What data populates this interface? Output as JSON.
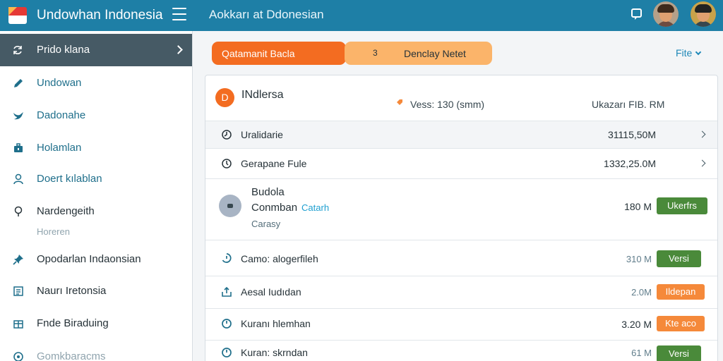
{
  "topbar": {
    "app_title": "Undowhan Indonesia",
    "page_heading": "Aokkarı at Ddonesian"
  },
  "sidebar": {
    "header_label": "Prido klana",
    "items": [
      {
        "label": "Undowan",
        "icon": "pencil-icon",
        "color": "#1f6f8b"
      },
      {
        "label": "Dadonahe",
        "icon": "bird-icon",
        "color": "#1f6f8b"
      },
      {
        "label": "Holamlan",
        "icon": "briefcase-icon",
        "color": "#1f6f8b"
      },
      {
        "label": "Doert kılablan",
        "icon": "user-icon",
        "color": "#1f6f8b"
      },
      {
        "label": "Nardengeith",
        "icon": "location-pin-icon",
        "color": "#263238"
      },
      {
        "label": "Opodarlan Indaonsian",
        "icon": "pin-icon",
        "color": "#263238"
      },
      {
        "label": "Naurı Iretonsia",
        "icon": "list-icon",
        "color": "#263238"
      },
      {
        "label": "Fnde Biraduing",
        "icon": "box-icon",
        "color": "#263238"
      },
      {
        "label": "Gomkbaracms",
        "icon": "refresh-icon",
        "color": "#90a4ae"
      }
    ],
    "sub_label": "Horeren"
  },
  "toolbar": {
    "search_pill": "Qatamanit Bacla",
    "pill_number": "3",
    "pill_label": "Denclay Netet",
    "filter_label": "Fite"
  },
  "panel": {
    "header": {
      "badge": "D",
      "title": "INdlersa",
      "version": "Vess: 130 (smm)",
      "size": "Ukazarı FIB. RM"
    },
    "files": [
      {
        "name": "Uralidarie",
        "size": "31115,50M"
      },
      {
        "name": "Gerapane Fule",
        "size": "1332,25.0M"
      }
    ],
    "user": {
      "line1": "Budola",
      "line2": "Conmban",
      "link": "Catarh",
      "line3": "Carasy",
      "size": "180 M",
      "button": "Ukerfrs"
    },
    "rows": [
      {
        "name": "Camo: alogerfileh",
        "size": "310 M",
        "button": "Versi",
        "button_color": "green"
      },
      {
        "name": "Aesal Iudıdan",
        "size": "2.0M",
        "button": "Ildepan",
        "button_color": "orange"
      },
      {
        "name": "Kuranı hlemhan",
        "size": "3.20 M",
        "button": "Kte aco",
        "button_color": "orange"
      },
      {
        "name": "Kuran: skrndan",
        "size": "61 M",
        "button": "Versi",
        "button_color": "green"
      }
    ]
  },
  "colors": {
    "topbar": "#1e7fa6",
    "accent_orange": "#f36c21",
    "accent_peach": "#fbb46a",
    "button_green": "#4a8a3a",
    "button_orange": "#f5893a",
    "sidebar_header": "#465a65"
  }
}
